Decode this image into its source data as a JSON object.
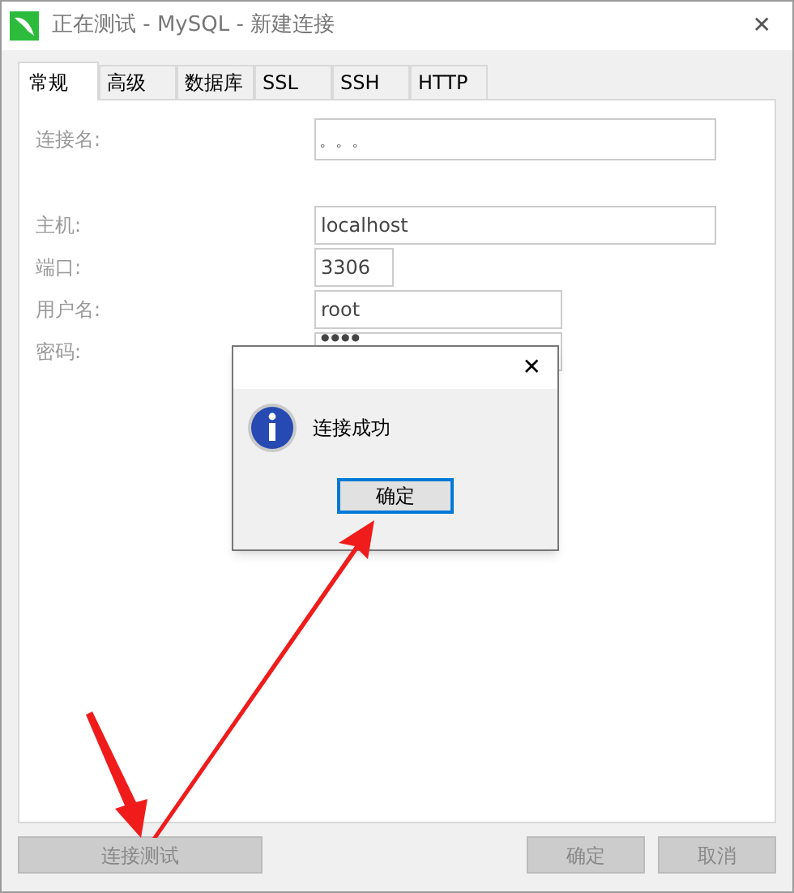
{
  "window": {
    "title": "正在测试 - MySQL - 新建连接",
    "close": "✕"
  },
  "tabs": [
    {
      "label": "常规",
      "selected": true
    },
    {
      "label": "高级",
      "selected": false
    },
    {
      "label": "数据库",
      "selected": false
    },
    {
      "label": "SSL",
      "selected": false
    },
    {
      "label": "SSH",
      "selected": false
    },
    {
      "label": "HTTP",
      "selected": false
    }
  ],
  "form": {
    "connection_name": {
      "label": "连接名:",
      "value": "。。。"
    },
    "fields": [
      {
        "label": "主机:",
        "value": "localhost"
      },
      {
        "label": "端口:",
        "value": "3306"
      },
      {
        "label": "用户名:",
        "value": "root"
      },
      {
        "label": "密码:",
        "value": "●●●●"
      }
    ]
  },
  "dialog": {
    "close": "✕",
    "message": "连接成功",
    "button": "确定"
  },
  "buttons": [
    {
      "label": "连接测试",
      "disabled": true
    },
    {
      "label": "确定",
      "disabled": true
    },
    {
      "label": "取消",
      "disabled": true
    }
  ]
}
